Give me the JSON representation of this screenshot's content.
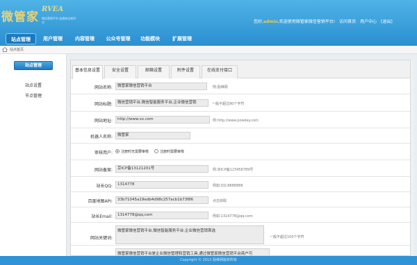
{
  "header": {
    "logo_text": "微管家",
    "logo_en": "RVEA",
    "logo_sub": "微信营销平台·连接商业新时代",
    "greeting_prefix": "您好,",
    "username": "admin",
    "greeting_suffix": ",欢迎使用微管家微信营销平台!",
    "links": [
      "访问首页",
      "用户中心",
      "[退出]"
    ]
  },
  "nav": [
    "站点管理",
    "用户管理",
    "内容管理",
    "公众号管理",
    "功能模块",
    "扩展管理"
  ],
  "breadcrumb": "站点首页",
  "sidebar": {
    "title": "站点管理",
    "items": [
      "站点设置",
      "节点管理"
    ]
  },
  "tabs": [
    "基本信息设置",
    "安全设置",
    "邮箱设置",
    "附件设置",
    "在线支付接口"
  ],
  "form": {
    "site_name": {
      "label": "网站名称:",
      "value": "微管家微信营销平台",
      "hint": "例:励维网"
    },
    "site_title": {
      "label": "网站标题:",
      "value": "微信营销平台,微信智能服务平台,企业微信营销",
      "hint": "一般不超过80个字符"
    },
    "site_url": {
      "label": "网站地址:",
      "value": "http://www.xx.com",
      "hint": "例:http://www.powkey.com"
    },
    "robot_name": {
      "label": "机器人名称:",
      "value": "微管家"
    },
    "review": {
      "label": "审核用户:",
      "option1": "注册时无需要审核",
      "option2": "注册时需要审核"
    },
    "icp": {
      "label": "网站备案:",
      "value": "京ICP备13121201号",
      "hint": "例:京ICP备123456789号"
    },
    "qq": {
      "label": "站长QQ:",
      "value": "1314778",
      "hint": "例如:QQ:8888888"
    },
    "baidu_api": {
      "label": "百度地图API:",
      "value": "33b71045a19edb4d98c257acb1b73f86",
      "hint": "点击获取"
    },
    "email": {
      "label": "站长Email:",
      "value": "1314778@qq.com",
      "hint": "例如:1314778@qq.com"
    },
    "keywords": {
      "label": "网站关键词:",
      "value": "微管家微信营销平台,微信智能服务平台,企业微信营销首选",
      "hint": "一般不超过100个字符"
    },
    "description": {
      "value": "微管家微信营销平台是企业微信管理和营销工具,通过微管家微信营销平台商户可"
    }
  },
  "footer": "Copyright © 2013 励维网版权所有"
}
